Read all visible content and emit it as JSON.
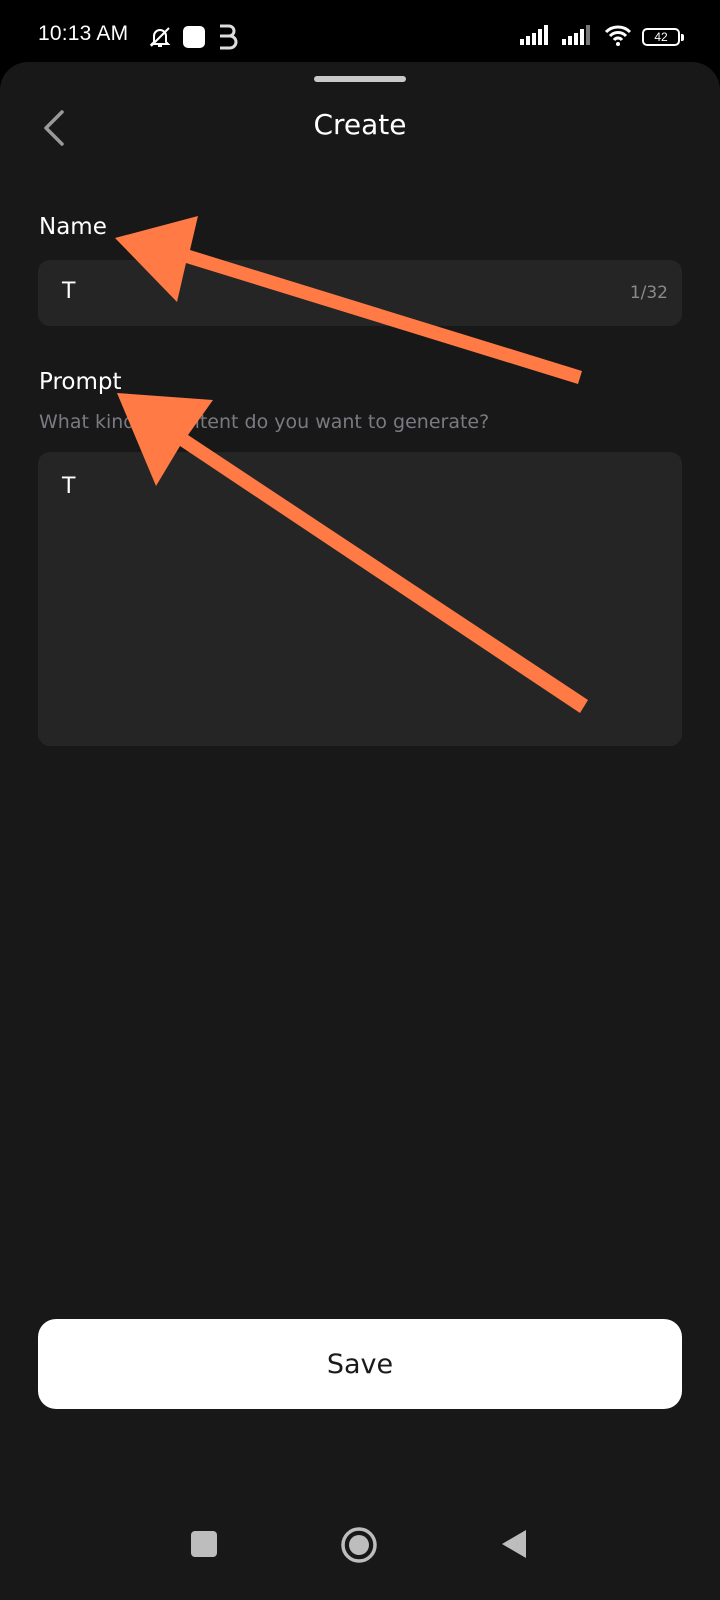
{
  "status_bar": {
    "time": "10:13 AM",
    "battery": "42",
    "icons": [
      "mute-notifications-icon",
      "square-notification-icon",
      "b-app-icon",
      "signal-icon",
      "signal-icon",
      "wifi-icon",
      "battery-icon"
    ]
  },
  "header": {
    "title": "Create",
    "back_icon": "chevron-left-icon"
  },
  "form": {
    "name": {
      "label": "Name",
      "value": "T",
      "counter": "1/32"
    },
    "prompt": {
      "label": "Prompt",
      "hint": "What kind of content do you want to generate?",
      "value": "T"
    },
    "save_label": "Save"
  },
  "nav_bar": {
    "icons": [
      "recents-square-icon",
      "home-circle-icon",
      "back-triangle-icon"
    ]
  },
  "colors": {
    "sheet_background": "#181818",
    "input_background": "#252525",
    "annotation_arrow": "#ff7a45",
    "save_button": "#ffffff"
  }
}
